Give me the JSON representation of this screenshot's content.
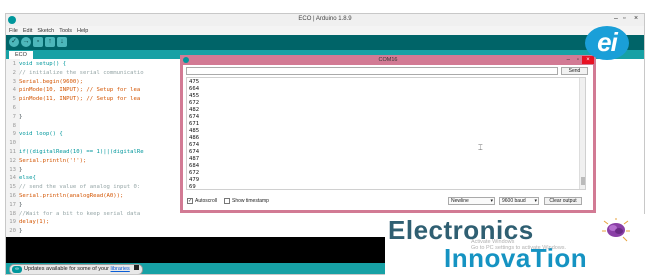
{
  "window": {
    "title": "ECO | Arduino 1.8.9",
    "min": "–",
    "max": "▫",
    "close": "×"
  },
  "menu": [
    "File",
    "Edit",
    "Sketch",
    "Tools",
    "Help"
  ],
  "toolbar": {
    "verify": "✓",
    "upload": "→",
    "new": "▫",
    "open": "↑",
    "save": "↓"
  },
  "tab": {
    "label": "ECO"
  },
  "code_lines": [
    {
      "n": "1",
      "text": "void setup() {"
    },
    {
      "n": "2",
      "text": "// initialize the serial communicatio"
    },
    {
      "n": "3",
      "text": "Serial.begin(9600);"
    },
    {
      "n": "4",
      "text": "pinMode(10, INPUT); // Setup for lea"
    },
    {
      "n": "5",
      "text": "pinMode(11, INPUT); // Setup for lea"
    },
    {
      "n": "6",
      "text": ""
    },
    {
      "n": "7",
      "text": "}"
    },
    {
      "n": "8",
      "text": ""
    },
    {
      "n": "9",
      "text": "void loop() {"
    },
    {
      "n": "10",
      "text": ""
    },
    {
      "n": "11",
      "text": "if((digitalRead(10) == 1)||(digitalRe"
    },
    {
      "n": "12",
      "text": "Serial.println('!');"
    },
    {
      "n": "13",
      "text": "}"
    },
    {
      "n": "14",
      "text": "else{"
    },
    {
      "n": "15",
      "text": "// send the value of analog input 0:"
    },
    {
      "n": "16",
      "text": "Serial.println(analogRead(A0));"
    },
    {
      "n": "17",
      "text": "}"
    },
    {
      "n": "18",
      "text": "//Wait for a bit to keep serial data"
    },
    {
      "n": "19",
      "text": "delay(1);"
    },
    {
      "n": "20",
      "text": "}"
    }
  ],
  "status": {
    "updates_text": "Updates available for some of your",
    "libraries_link": "libraries",
    "ard_logo": "∞"
  },
  "serial_monitor": {
    "title": "COM16",
    "min": "–",
    "max": "▫",
    "close": "×",
    "input_value": "",
    "send_label": "Send",
    "output_lines": [
      "475",
      "664",
      "455",
      "672",
      "482",
      "674",
      "671",
      "485",
      "486",
      "674",
      "674",
      "487",
      "684",
      "672",
      "479",
      "69"
    ],
    "autoscroll_checked": true,
    "autoscroll_label": "Autoscroll",
    "timestamp_checked": false,
    "timestamp_label": "Show timestamp",
    "line_ending": "Newline",
    "baud": "9600 baud",
    "clear_label": "Clear output"
  },
  "logo": {
    "text": "ei"
  },
  "brand": {
    "line1": "Electronics",
    "line2": "InnovaTion"
  },
  "watermark": {
    "line1": "Activate Windows",
    "line2": "Go to PC settings to activate Windows."
  },
  "colors": {
    "teal_dark": "#006468",
    "teal": "#17a1a5",
    "serial_frame": "#d27a94",
    "brand_dark": "#2f5f72",
    "brand_blue": "#1593c2",
    "logo_blue": "#1a9fd8"
  }
}
